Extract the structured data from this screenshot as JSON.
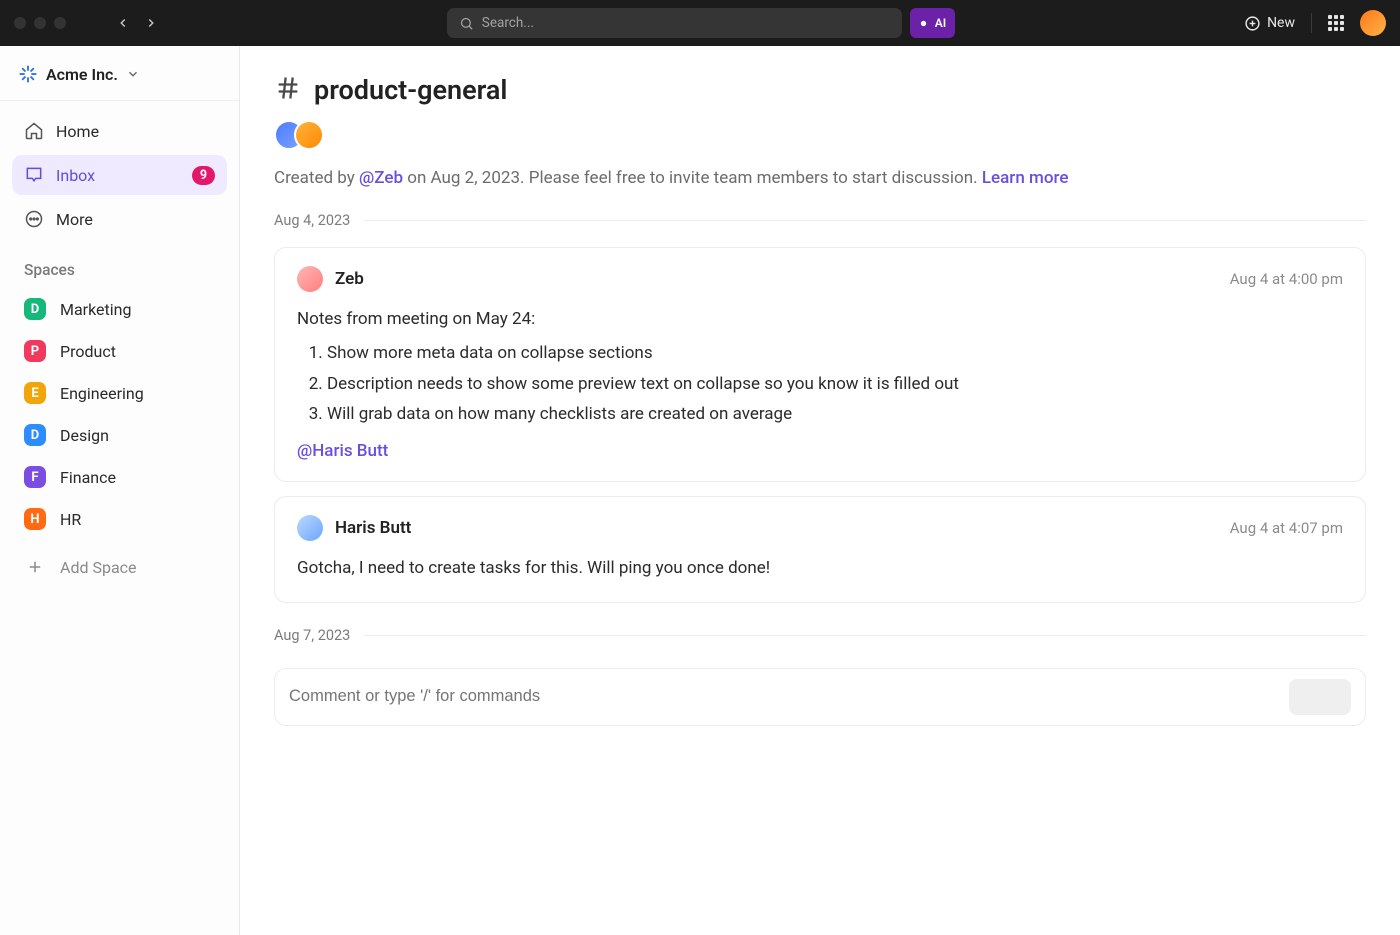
{
  "titlebar": {
    "search_placeholder": "Search...",
    "ai_label": "AI",
    "new_label": "New"
  },
  "workspace": {
    "name": "Acme Inc."
  },
  "nav": {
    "home": "Home",
    "inbox": "Inbox",
    "inbox_badge": "9",
    "more": "More"
  },
  "spaces_header": "Spaces",
  "spaces": [
    {
      "letter": "D",
      "label": "Marketing",
      "color": "#16b77a"
    },
    {
      "letter": "P",
      "label": "Product",
      "color": "#ef3a5d"
    },
    {
      "letter": "E",
      "label": "Engineering",
      "color": "#f2a50a"
    },
    {
      "letter": "D",
      "label": "Design",
      "color": "#2d8cff"
    },
    {
      "letter": "F",
      "label": "Finance",
      "color": "#7b4de0"
    },
    {
      "letter": "H",
      "label": "HR",
      "color": "#ff6a13"
    }
  ],
  "add_space": "Add Space",
  "channel": {
    "name": "product-general",
    "desc_prefix": "Created by ",
    "desc_creator": "@Zeb",
    "desc_middle": " on Aug 2, 2023. Please feel free to invite team members to start discussion. ",
    "learn_more": "Learn more"
  },
  "dividers": {
    "d1": "Aug 4, 2023",
    "d2": "Aug 7, 2023"
  },
  "messages": [
    {
      "author": "Zeb",
      "time": "Aug 4 at 4:00 pm",
      "lead": "Notes from meeting on May 24:",
      "items": [
        "Show more meta data on collapse sections",
        "Description needs to show some preview text on collapse so you know it is filled out",
        "Will grab data on how many checklists are created on average"
      ],
      "mention": "@Haris Butt"
    },
    {
      "author": "Haris Butt",
      "time": "Aug 4 at 4:07 pm",
      "text": "Gotcha, I need to create tasks for this. Will ping you once done!"
    }
  ],
  "composer": {
    "placeholder": "Comment or type '/' for commands"
  }
}
